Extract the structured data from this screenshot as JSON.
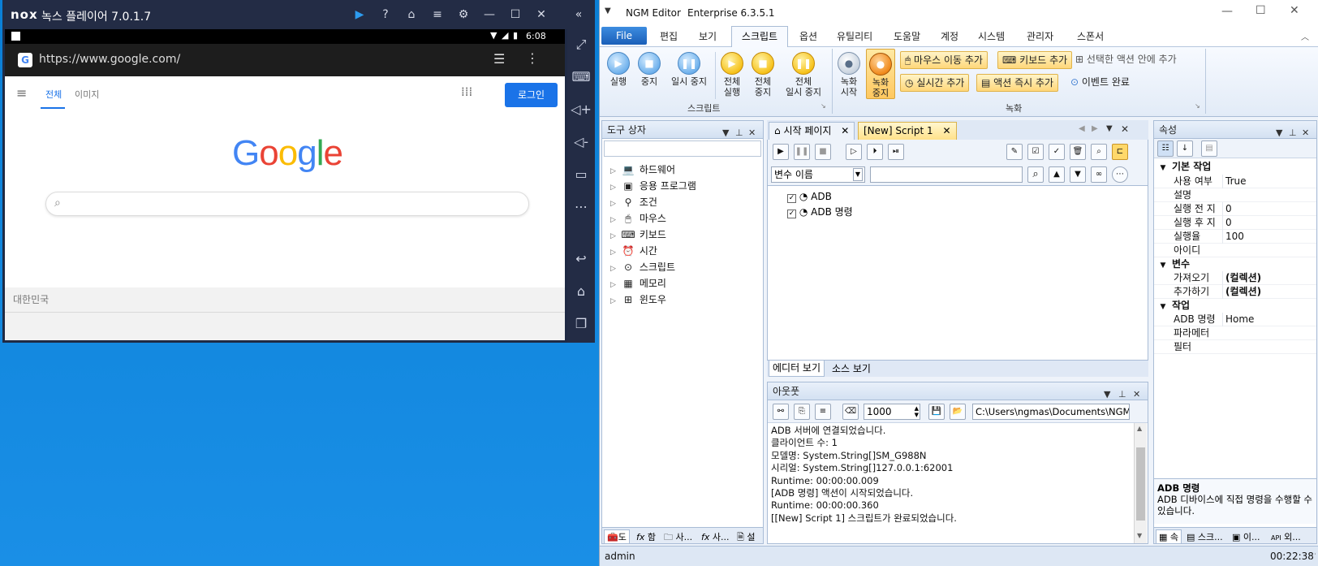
{
  "nox": {
    "logo": "nox",
    "title": "녹스 플레이어 7.0.1.7",
    "clock": "6:08",
    "url": "https://www.google.com/",
    "tabs": [
      "전체",
      "이미지"
    ],
    "login_label": "로그인",
    "google_letters": [
      "G",
      "o",
      "o",
      "g",
      "l",
      "e"
    ],
    "google_colors": [
      "#4285F4",
      "#EA4335",
      "#FBBC05",
      "#4285F4",
      "#34A853",
      "#EA4335"
    ],
    "country": "대한민국"
  },
  "ngm": {
    "app_name": "NGM Editor",
    "edition": "Enterprise 6.3.5.1",
    "menu": [
      "File",
      "편집",
      "보기",
      "스크립트",
      "옵션",
      "유틸리티",
      "도움말",
      "계정",
      "시스템",
      "관리자",
      "스폰서"
    ],
    "ribbon": {
      "run": "실행",
      "stop": "중지",
      "pause": "일시 중지",
      "run_all_1": "전체",
      "run_all_2": "실행",
      "stop_all_1": "전체",
      "stop_all_2": "중지",
      "pause_all_1": "전체",
      "pause_all_2": "일시 중지",
      "script_group": "스크립트",
      "rec_start_1": "녹화",
      "rec_start_2": "시작",
      "rec_stop_1": "녹화",
      "rec_stop_2": "중지",
      "add_mouse": "마우스 이동 추가",
      "add_keyboard": "키보드 추가",
      "add_to_selected": "선택한 액션 안에 추가",
      "add_realtime": "실시간 추가",
      "add_action_now": "액션 즉시 추가",
      "event_done": "이벤트 완료",
      "record_group": "녹화"
    },
    "toolbox": {
      "title": "도구 상자",
      "items": [
        "하드웨어",
        "응용 프로그램",
        "조건",
        "마우스",
        "키보드",
        "시간",
        "스크립트",
        "메모리",
        "윈도우"
      ],
      "bottom_tabs": [
        "도",
        "함",
        "사...",
        "사...",
        "설"
      ]
    },
    "doc": {
      "tab_start": "시작 페이지",
      "tab_script": "[New] Script 1",
      "var_placeholder": "변수 이름",
      "actions": [
        "ADB",
        "ADB 명령"
      ],
      "view_editor": "에디터 보기",
      "view_source": "소스 보기"
    },
    "output": {
      "title": "아웃풋",
      "count": "1000",
      "path": "C:\\Users\\ngmas\\Documents\\NGM6\\",
      "lines": [
        "ADB 서버에 연결되었습니다.",
        "클라이언트 수: 1",
        "모델명: System.String[]SM_G988N",
        "시리얼: System.String[]127.0.0.1:62001",
        "Runtime: 00:00:00.009",
        "[ADB 명령] 액션이 시작되었습니다.",
        "Runtime: 00:00:00.360",
        "[[New] Script 1] 스크립트가 완료되었습니다."
      ]
    },
    "props": {
      "title": "속성",
      "cat_basic": "기본 작업",
      "cat_var": "변수",
      "cat_task": "작업",
      "rows_basic": [
        {
          "k": "사용 여부",
          "v": "True"
        },
        {
          "k": "설명",
          "v": ""
        },
        {
          "k": "실행 전 지",
          "v": "0"
        },
        {
          "k": "실행 후 지",
          "v": "0"
        },
        {
          "k": "실행율",
          "v": "100"
        },
        {
          "k": "아이디",
          "v": ""
        }
      ],
      "rows_var": [
        {
          "k": "가져오기",
          "v": "(컬렉션)"
        },
        {
          "k": "추가하기",
          "v": "(컬렉션)"
        }
      ],
      "rows_task": [
        {
          "k": "ADB 명령",
          "v": "Home"
        },
        {
          "k": "파라메터",
          "v": ""
        },
        {
          "k": "필터",
          "v": ""
        }
      ],
      "desc_title": "ADB 명령",
      "desc_text": "ADB 디바이스에 직접 명령을 수행할 수 있습니다.",
      "bottom_tabs": [
        "속",
        "스크...",
        "이...",
        "외..."
      ]
    },
    "status": {
      "user": "admin",
      "time": "00:22:38"
    }
  }
}
